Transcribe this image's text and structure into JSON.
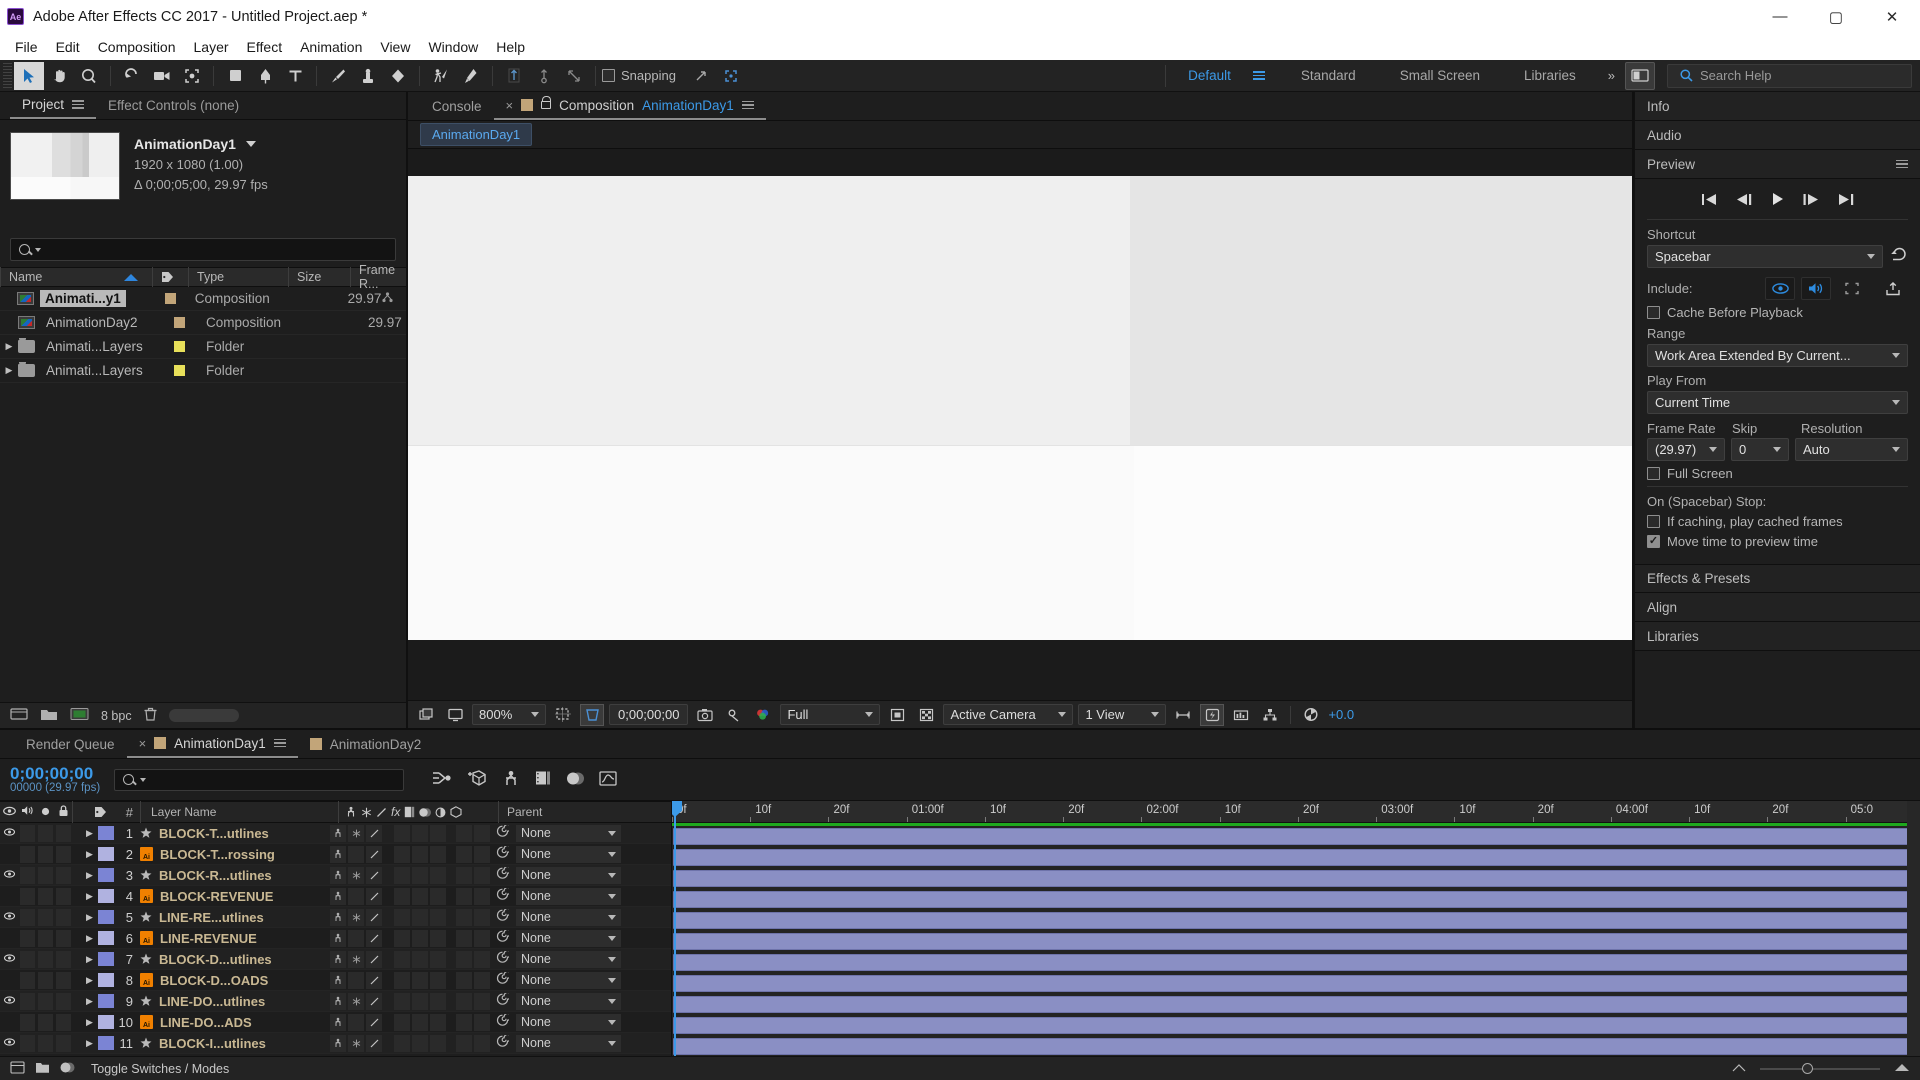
{
  "window": {
    "app_icon": "Ae",
    "title": "Adobe After Effects CC 2017 - Untitled Project.aep *",
    "minimize": "—",
    "maximize": "▢",
    "close": "✕"
  },
  "menu": [
    "File",
    "Edit",
    "Composition",
    "Layer",
    "Effect",
    "Animation",
    "View",
    "Window",
    "Help"
  ],
  "toolbar": {
    "snapping_label": "Snapping",
    "workspaces": [
      "Default",
      "Standard",
      "Small Screen",
      "Libraries"
    ],
    "selected_workspace": "Default",
    "overflow": "»",
    "search_help_placeholder": "Search Help"
  },
  "project_panel": {
    "tabs": [
      {
        "label": "Project",
        "selected": true
      },
      {
        "label": "Effect Controls (none)",
        "selected": false
      }
    ],
    "selected_item": {
      "name": "AnimationDay1",
      "resolution": "1920 x 1080 (1.00)",
      "duration": "Δ 0;00;05;00, 29.97 fps"
    },
    "search_placeholder": "",
    "columns": [
      "Name",
      "Type",
      "Size",
      "Frame R..."
    ],
    "items": [
      {
        "name": "Animati...y1",
        "type": "Composition",
        "size": "",
        "framerate": "29.97",
        "kind": "comp",
        "tag": "#c2a579",
        "selected": true,
        "expandable": false
      },
      {
        "name": "AnimationDay2",
        "type": "Composition",
        "size": "",
        "framerate": "29.97",
        "kind": "comp",
        "tag": "#c2a579",
        "selected": false,
        "expandable": false
      },
      {
        "name": "Animati...Layers",
        "type": "Folder",
        "size": "",
        "framerate": "",
        "kind": "folder",
        "tag": "#e8e05a",
        "selected": false,
        "expandable": true
      },
      {
        "name": "Animati...Layers",
        "type": "Folder",
        "size": "",
        "framerate": "",
        "kind": "folder",
        "tag": "#e8e05a",
        "selected": false,
        "expandable": true
      }
    ],
    "footer": {
      "bit_depth": "8 bpc"
    }
  },
  "composition_panel": {
    "tabs": [
      {
        "label": "Console",
        "selected": false
      },
      {
        "label": "Composition",
        "comp_name": "AnimationDay1",
        "selected": true
      }
    ],
    "sub_tab": "AnimationDay1",
    "viewer_toolbar": {
      "magnification": "800%",
      "current_time": "0;00;00;00",
      "resolution": "Full",
      "camera": "Active Camera",
      "views": "1 View",
      "exposure": "+0.0"
    }
  },
  "right_panel": {
    "sections": [
      "Info",
      "Audio",
      "Preview",
      "Effects & Presets",
      "Align",
      "Libraries"
    ],
    "preview": {
      "title": "Preview",
      "shortcut_label": "Shortcut",
      "shortcut_value": "Spacebar",
      "include_label": "Include:",
      "cache_before_playback": "Cache Before Playback",
      "cache_before_playback_checked": false,
      "range_label": "Range",
      "range_value": "Work Area Extended By Current...",
      "play_from_label": "Play From",
      "play_from_value": "Current Time",
      "frame_rate_label": "Frame Rate",
      "frame_rate_value": "(29.97)",
      "skip_label": "Skip",
      "skip_value": "0",
      "resolution_label": "Resolution",
      "resolution_value": "Auto",
      "full_screen": "Full Screen",
      "full_screen_checked": false,
      "on_stop_label": "On (Spacebar) Stop:",
      "if_caching": "If caching, play cached frames",
      "if_caching_checked": false,
      "move_time": "Move time to preview time",
      "move_time_checked": true
    }
  },
  "timeline": {
    "tabs": [
      {
        "label": "Render Queue",
        "selected": false
      },
      {
        "label": "AnimationDay1",
        "selected": true
      },
      {
        "label": "AnimationDay2",
        "selected": false
      }
    ],
    "current_time": "0;00;00;00",
    "frame_info": "00000 (29.97 fps)",
    "search_placeholder": "",
    "columns": [
      "#",
      "Layer Name",
      "Parent"
    ],
    "layers": [
      {
        "num": "1",
        "name": "BLOCK-T...utlines",
        "kind": "shape",
        "video": true,
        "label": "#7b84d4",
        "parent": "None"
      },
      {
        "num": "2",
        "name": "BLOCK-T...rossing",
        "kind": "ai",
        "video": false,
        "label": "#b0b2e0",
        "parent": "None"
      },
      {
        "num": "3",
        "name": "BLOCK-R...utlines",
        "kind": "shape",
        "video": true,
        "label": "#7b84d4",
        "parent": "None"
      },
      {
        "num": "4",
        "name": "BLOCK-REVENUE",
        "kind": "ai",
        "video": false,
        "label": "#b0b2e0",
        "parent": "None"
      },
      {
        "num": "5",
        "name": "LINE-RE...utlines",
        "kind": "shape",
        "video": true,
        "label": "#7b84d4",
        "parent": "None"
      },
      {
        "num": "6",
        "name": "LINE-REVENUE",
        "kind": "ai",
        "video": false,
        "label": "#b0b2e0",
        "parent": "None"
      },
      {
        "num": "7",
        "name": "BLOCK-D...utlines",
        "kind": "shape",
        "video": true,
        "label": "#7b84d4",
        "parent": "None"
      },
      {
        "num": "8",
        "name": "BLOCK-D...OADS",
        "kind": "ai",
        "video": false,
        "label": "#b0b2e0",
        "parent": "None"
      },
      {
        "num": "9",
        "name": "LINE-DO...utlines",
        "kind": "shape",
        "video": true,
        "label": "#7b84d4",
        "parent": "None"
      },
      {
        "num": "10",
        "name": "LINE-DO...ADS",
        "kind": "ai",
        "video": false,
        "label": "#b0b2e0",
        "parent": "None"
      },
      {
        "num": "11",
        "name": "BLOCK-I...utlines",
        "kind": "shape",
        "video": true,
        "label": "#7b84d4",
        "parent": "None"
      }
    ],
    "ruler_ticks": [
      "0f",
      "10f",
      "20f",
      "01:00f",
      "10f",
      "20f",
      "02:00f",
      "10f",
      "20f",
      "03:00f",
      "10f",
      "20f",
      "04:00f",
      "10f",
      "20f",
      "05:0"
    ],
    "footer": {
      "toggle_switches": "Toggle Switches / Modes"
    }
  },
  "colors": {
    "accent_blue": "#3c9ae8",
    "bar_purple": "#8a8fc4",
    "work_area": "#6e6e6e",
    "layer_name_text": "#c9b893",
    "green_line": "#1ea81e"
  }
}
